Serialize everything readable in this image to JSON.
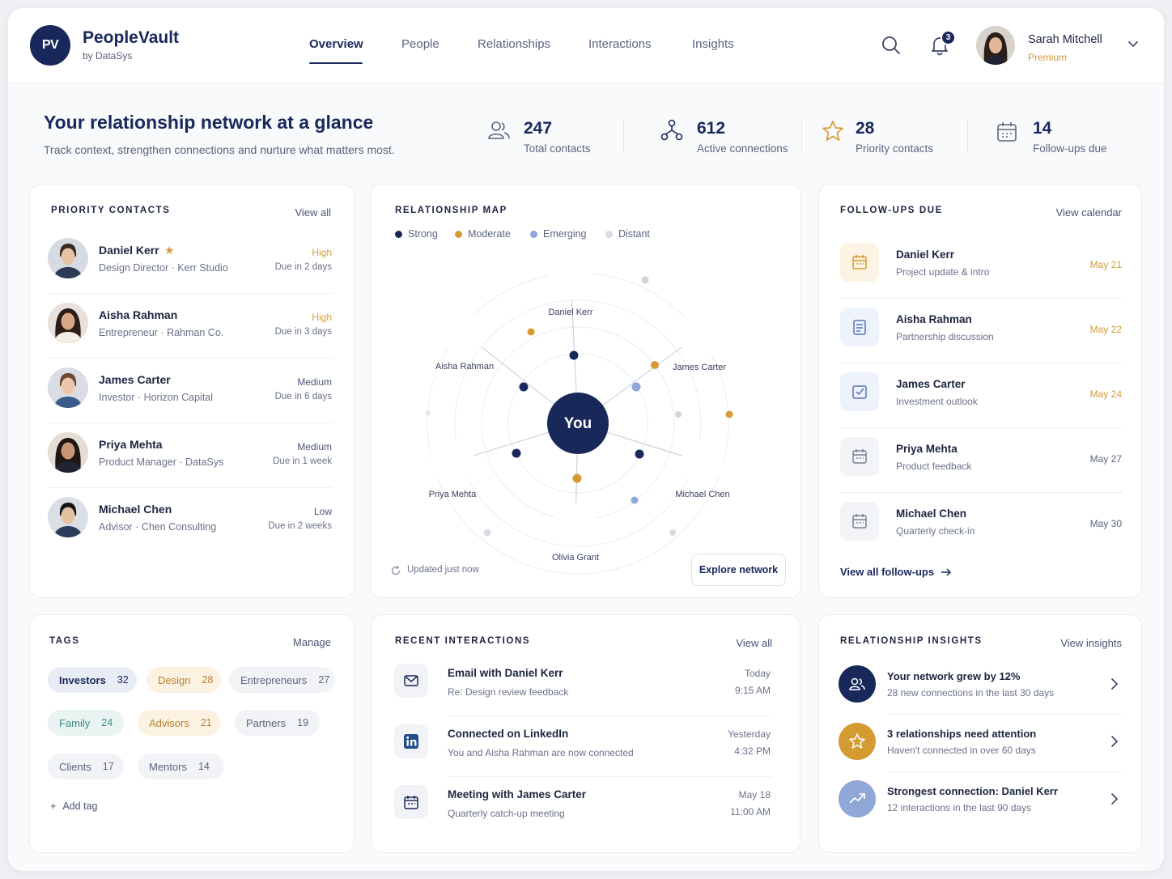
{
  "app": {
    "logo": "PV",
    "name": "PeopleVault",
    "by": "by DataSys"
  },
  "nav": [
    "Overview",
    "People",
    "Relationships",
    "Interactions",
    "Insights"
  ],
  "header": {
    "notifications_count": "3",
    "user_name": "Sarah Mitchell",
    "user_plan": "Premium"
  },
  "hero": {
    "title": "Your relationship network at a glance",
    "subtitle": "Track context, strengthen connections and nurture what matters most.",
    "stats": [
      {
        "value": "247",
        "label": "Total contacts",
        "icon": "users-icon"
      },
      {
        "value": "612",
        "label": "Active connections",
        "icon": "network-icon"
      },
      {
        "value": "28",
        "label": "Priority contacts",
        "icon": "star-icon"
      },
      {
        "value": "14",
        "label": "Follow-ups due",
        "icon": "calendar-icon"
      }
    ]
  },
  "priority": {
    "title": "PRIORITY CONTACTS",
    "link": "View all",
    "contacts": [
      {
        "name": "Daniel Kerr",
        "role": "Design Director · Kerr Studio",
        "priority": "High",
        "due": "Due in 2 days",
        "starred": true
      },
      {
        "name": "Aisha Rahman",
        "role": "Entrepreneur · Rahman Co.",
        "priority": "High",
        "due": "Due in 3 days"
      },
      {
        "name": "James Carter",
        "role": "Investor · Horizon Capital",
        "priority": "Medium",
        "due": "Due in 6 days"
      },
      {
        "name": "Priya Mehta",
        "role": "Product Manager · DataSys",
        "priority": "Medium",
        "due": "Due in 1 week"
      },
      {
        "name": "Michael Chen",
        "role": "Advisor · Chen Consulting",
        "priority": "Low",
        "due": "Due in 2 weeks"
      }
    ]
  },
  "map": {
    "title": "RELATIONSHIP MAP",
    "legend": [
      {
        "label": "Strong",
        "color": "#18285b"
      },
      {
        "label": "Moderate",
        "color": "#d59b33"
      },
      {
        "label": "Emerging",
        "color": "#8fa8d8"
      },
      {
        "label": "Distant",
        "color": "#d7dbe3"
      }
    ],
    "center": "You",
    "people": [
      "Daniel Kerr",
      "Aisha Rahman",
      "James Carter",
      "Priya Mehta",
      "Michael Chen",
      "Olivia Grant"
    ],
    "updated": "Updated just now",
    "button": "Explore network"
  },
  "followups": {
    "title": "FOLLOW-UPS DUE",
    "link": "View calendar",
    "items": [
      {
        "name": "Daniel Kerr",
        "topic": "Project update & intro",
        "date": "May 21"
      },
      {
        "name": "Aisha Rahman",
        "topic": "Partnership discussion",
        "date": "May 22"
      },
      {
        "name": "James Carter",
        "topic": "Investment outlook",
        "date": "May 24"
      },
      {
        "name": "Priya Mehta",
        "topic": "Product feedback",
        "date": "May 27"
      },
      {
        "name": "Michael Chen",
        "topic": "Quarterly check-in",
        "date": "May 30"
      }
    ],
    "footer": "View all follow-ups"
  },
  "tags": {
    "title": "TAGS",
    "link": "Manage",
    "items": [
      {
        "label": "Investors",
        "count": "32"
      },
      {
        "label": "Design",
        "count": "28"
      },
      {
        "label": "Entrepreneurs",
        "count": "27"
      },
      {
        "label": "Family",
        "count": "24"
      },
      {
        "label": "Advisors",
        "count": "21"
      },
      {
        "label": "Partners",
        "count": "19"
      },
      {
        "label": "Clients",
        "count": "17"
      },
      {
        "label": "Mentors",
        "count": "14"
      }
    ],
    "add": "Add tag"
  },
  "interactions": {
    "title": "RECENT INTERACTIONS",
    "link": "View all",
    "items": [
      {
        "title": "Email with Daniel Kerr",
        "sub": "Re: Design review feedback",
        "day": "Today",
        "time": "9:15 AM",
        "icon": "mail-icon"
      },
      {
        "title": "Connected on LinkedIn",
        "sub": "You and Aisha Rahman are now connected",
        "day": "Yesterday",
        "time": "4:32 PM",
        "icon": "linkedin-icon"
      },
      {
        "title": "Meeting with James Carter",
        "sub": "Quarterly catch-up meeting",
        "day": "May 18",
        "time": "11:00 AM",
        "icon": "calendar-icon"
      }
    ]
  },
  "insights": {
    "title": "RELATIONSHIP INSIGHTS",
    "link": "View insights",
    "items": [
      {
        "title": "Your network grew by 12%",
        "sub": "28 new connections in the last 30 days"
      },
      {
        "title": "3 relationships need attention",
        "sub": "Haven't connected in over 60 days"
      },
      {
        "title": "Strongest connection: Daniel Kerr",
        "sub": "12 interactions in the last 90 days"
      }
    ]
  },
  "colors": {
    "navy": "#18285b",
    "gold": "#d59b33",
    "blue": "#8fa8d8",
    "grey": "#d7dbe3"
  }
}
